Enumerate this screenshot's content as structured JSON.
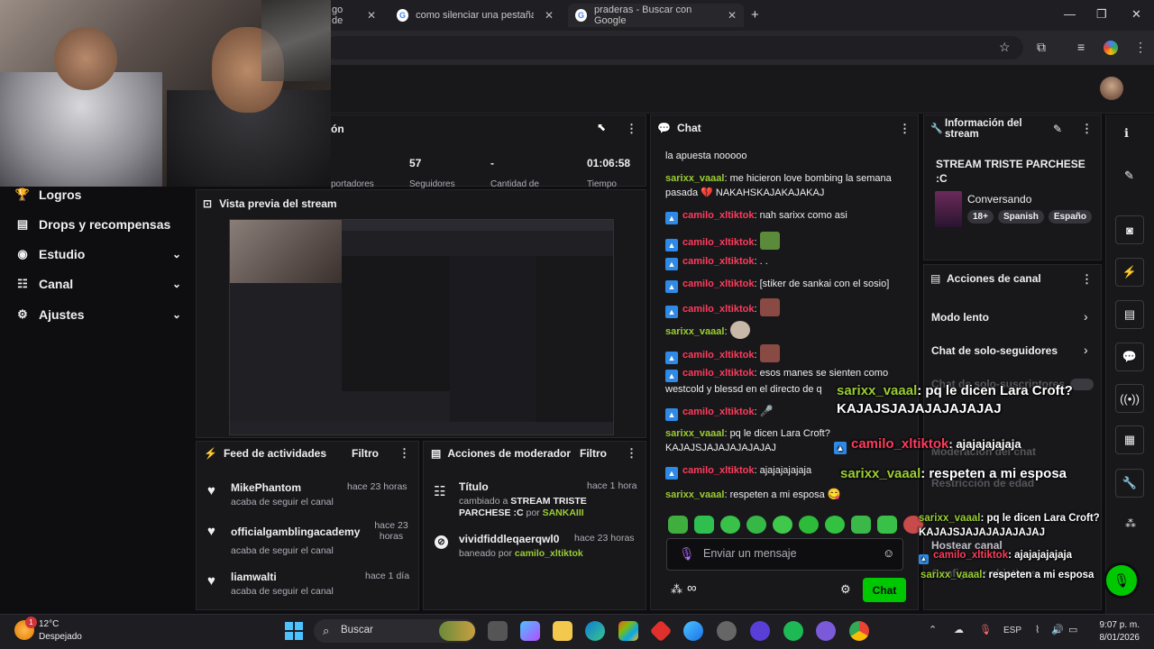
{
  "browser": {
    "tabs": [
      {
        "title": "go de",
        "close": "✕"
      },
      {
        "title": "como silenciar una pestaña - Bu",
        "close": "✕"
      },
      {
        "title": "praderas - Buscar con Google",
        "close": "✕"
      }
    ],
    "new_tab": "+",
    "window_controls": [
      "—",
      "❐",
      "✕"
    ]
  },
  "sidebar": {
    "items": [
      {
        "label": "Logros",
        "icon": "trophy-icon",
        "glyph": "🏆"
      },
      {
        "label": "Drops y recompensas",
        "icon": "drops-icon",
        "glyph": "▤"
      },
      {
        "label": "Estudio",
        "icon": "studio-icon",
        "glyph": "◉",
        "chevron": "⌄"
      },
      {
        "label": "Canal",
        "icon": "channel-icon",
        "glyph": "☷",
        "chevron": "⌄"
      },
      {
        "label": "Ajustes",
        "icon": "gear-icon",
        "glyph": "⚙",
        "chevron": "⌄"
      }
    ]
  },
  "session": {
    "title_fragment": "ón",
    "stats": [
      {
        "value": "57",
        "label": "Seguidores"
      },
      {
        "value": "-",
        "label": "Cantidad de"
      },
      {
        "value": "01:06:58",
        "label": "Tiempo"
      }
    ],
    "stat_sub_fragment": "portadores"
  },
  "preview": {
    "title": "Vista previa del stream"
  },
  "activity": {
    "title": "Feed de actividades",
    "filter": "Filtro",
    "items": [
      {
        "name": "MikePhantom",
        "desc": "acaba de seguir el canal",
        "time": "hace 23 horas"
      },
      {
        "name": "officialgamblingacademy",
        "desc": "acaba de seguir el canal",
        "time": "hace 23 horas"
      },
      {
        "name": "liamwalti",
        "desc": "acaba de seguir el canal",
        "time": "hace 1 día"
      }
    ]
  },
  "modactions": {
    "title": "Acciones de moderador",
    "filter": "Filtro",
    "items": [
      {
        "name": "Título",
        "desc_prefix": "cambiado a ",
        "desc_value": "STREAM TRISTE PARCHESE :C",
        "by": " por ",
        "user": "SANKAIII",
        "time": "hace 1 hora"
      },
      {
        "name": "vividfiddleqaerqwl0",
        "desc_prefix": "baneado por ",
        "user": "camilo_xltiktok",
        "time": "hace 23 horas"
      }
    ]
  },
  "chat": {
    "title": "Chat",
    "cut_top": "la apuesta nooooo",
    "messages": [
      {
        "user": "sarixx_vaaal",
        "text": ": me hicieron love bombing la semana pasada 💔 NAKAHSKAJAKAJAKAJ"
      },
      {
        "user": "camilo_xltiktok",
        "text": ": nah sarixx como asi"
      },
      {
        "user": "camilo_xltiktok",
        "text": ":"
      },
      {
        "user": "camilo_xltiktok",
        "text": ": . ."
      },
      {
        "user": "camilo_xltiktok",
        "text": ": [stiker de sankai con el sosio]"
      },
      {
        "user": "camilo_xltiktok",
        "text": ":"
      },
      {
        "user": "sarixx_vaaal",
        "text": ":"
      },
      {
        "user": "camilo_xltiktok",
        "text": ":"
      },
      {
        "user": "camilo_xltiktok",
        "text": ": esos manes se sienten como westcold y blessd en el directo de q"
      },
      {
        "user": "camilo_xltiktok",
        "text": ":"
      },
      {
        "user": "sarixx_vaaal",
        "text": ": pq le dicen Lara Croft? KAJAJSJAJAJAJAJAJAJ"
      },
      {
        "user": "camilo_xltiktok",
        "text": ": ajajajajajaja"
      },
      {
        "user": "sarixx_vaaal",
        "text": ": respeten a mi esposa"
      }
    ],
    "placeholder": "Enviar un mensaje",
    "send": "Chat",
    "points": "∞"
  },
  "streaminfo": {
    "title": "Información del stream",
    "stream_title": "STREAM TRISTE PARCHESE :C",
    "category": "Conversando",
    "tags": [
      "18+",
      "Spanish",
      "Españo"
    ]
  },
  "channelactions": {
    "title": "Acciones de canal",
    "items": [
      "Modo lento",
      "Chat de solo-seguidores",
      "Chat de solo-suscriptores",
      "Moderación del chat",
      "Restricción de edad",
      "Hostear canal",
      "Configurar objetivos"
    ]
  },
  "overlay": {
    "big": [
      {
        "user": "sarixx_vaaal",
        "text": ": pq le dicen Lara Croft? KAJAJSJAJAJAJAJAJAJ"
      },
      {
        "user": "camilo_xltiktok",
        "text": ": ajajajajajaja"
      },
      {
        "user": "sarixx_vaaal",
        "text": ": respeten a mi esposa"
      }
    ],
    "small": [
      {
        "user": "sarixx_vaaal",
        "text": ": pq le dicen Lara Croft? KAJAJSJAJAJAJAJAJAJ"
      },
      {
        "user": "camilo_xltiktok",
        "text": ": ajajajajajaja"
      },
      {
        "user": "sarixx_vaaal",
        "text": ": respeten a mi esposa"
      }
    ]
  },
  "taskbar": {
    "weather_temp": "12°C",
    "weather_desc": "Despejado",
    "weather_badge": "1",
    "search": "Buscar",
    "lang": "ESP",
    "time": "9:07 p. m.",
    "date": "8/01/2026"
  }
}
